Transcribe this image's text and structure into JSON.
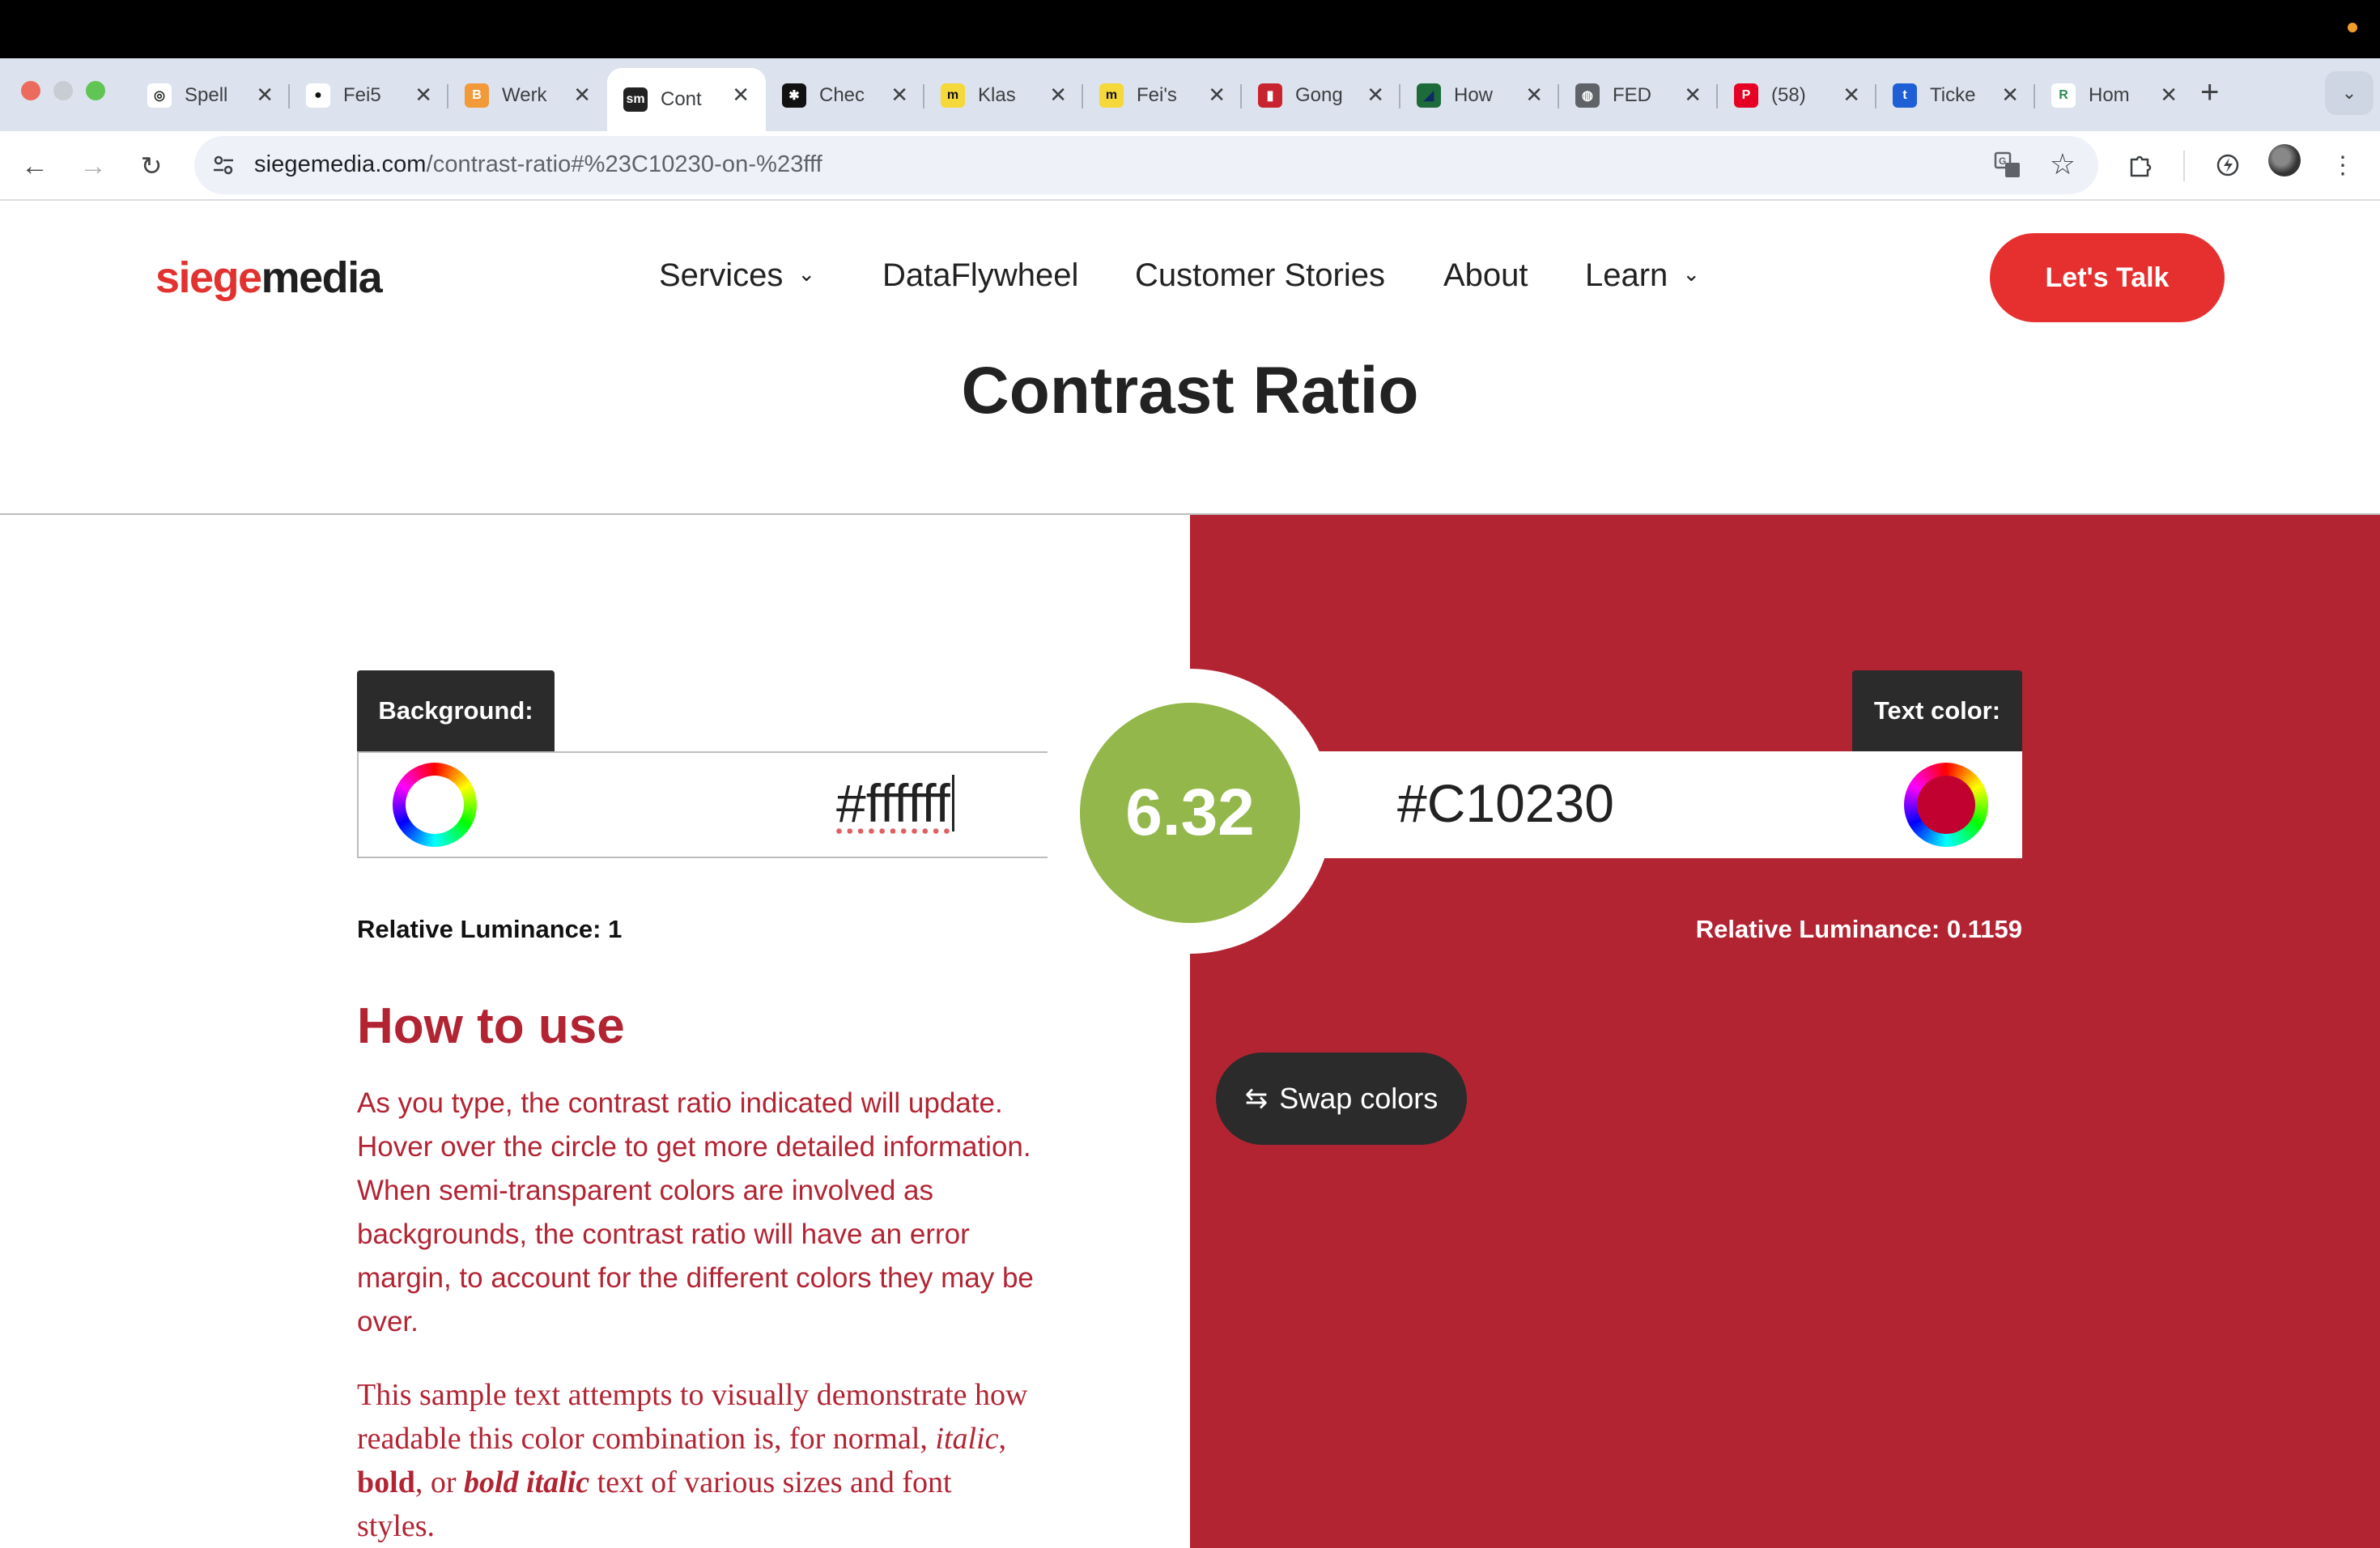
{
  "browser": {
    "tabs": [
      {
        "title": "Spell",
        "fav_bg": "#ffffff",
        "fav_glyph": "◎",
        "fav_color": "#222"
      },
      {
        "title": "Fei5",
        "fav_bg": "#ffffff",
        "fav_glyph": "●",
        "fav_color": "#111"
      },
      {
        "title": "Werk",
        "fav_bg": "#f29a3a",
        "fav_glyph": "B",
        "fav_color": "#fff"
      },
      {
        "title": "Cont",
        "fav_bg": "#222222",
        "fav_glyph": "sm",
        "fav_color": "#fff",
        "active": true
      },
      {
        "title": "Chec",
        "fav_bg": "#111111",
        "fav_glyph": "✱",
        "fav_color": "#fff"
      },
      {
        "title": "Klas",
        "fav_bg": "#f5d83a",
        "fav_glyph": "m",
        "fav_color": "#111"
      },
      {
        "title": "Fei's",
        "fav_bg": "#f5d83a",
        "fav_glyph": "m",
        "fav_color": "#111"
      },
      {
        "title": "Gong",
        "fav_bg": "#c8242f",
        "fav_glyph": "▮",
        "fav_color": "#fff"
      },
      {
        "title": "How",
        "fav_bg": "#1d6b3a",
        "fav_glyph": "◢",
        "fav_color": "#0d2a66"
      },
      {
        "title": "FED",
        "fav_bg": "#5f6368",
        "fav_glyph": "◍",
        "fav_color": "#fff"
      },
      {
        "title": "(58)",
        "fav_bg": "#e60023",
        "fav_glyph": "P",
        "fav_color": "#fff"
      },
      {
        "title": "Ticke",
        "fav_bg": "#1f5fd6",
        "fav_glyph": "t",
        "fav_color": "#fff"
      },
      {
        "title": "Hom",
        "fav_bg": "#ffffff",
        "fav_glyph": "R",
        "fav_color": "#2e8b57"
      }
    ],
    "url_domain": "siegemedia.com",
    "url_path": "/contrast-ratio#%23C10230-on-%23fff"
  },
  "site": {
    "logo_a": "siege",
    "logo_b": "media",
    "nav": {
      "services": "Services",
      "dataflywheel": "DataFlywheel",
      "customer_stories": "Customer Stories",
      "about": "About",
      "learn": "Learn"
    },
    "cta": "Let's Talk",
    "brand_color": "#e6302f"
  },
  "page": {
    "title": "Contrast Ratio",
    "background_label": "Background:",
    "background_value": "#ffffff",
    "text_color_label": "Text color:",
    "text_color_value": "#C10230",
    "ratio": "6.32",
    "ratio_color": "#93b74a",
    "lum_label": "Relative Luminance:",
    "bg_luminance": "1",
    "text_luminance": "0.1159",
    "swap_label": "Swap colors",
    "howto_heading": "How to use",
    "howto_text": "As you type, the contrast ratio indicated will update. Hover over the circle to get more detailed information. When semi-transparent colors are involved as backgrounds, the contrast ratio will have an error margin, to account for the different colors they may be over.",
    "sample": {
      "pre": "This sample text attempts to visually demonstrate how readable this color combination is, for normal,",
      "italic": "italic",
      "comma": ",",
      "bold": "bold",
      "or": ", or",
      "bold_italic": "bold italic",
      "post": "text of various sizes and font styles."
    }
  }
}
